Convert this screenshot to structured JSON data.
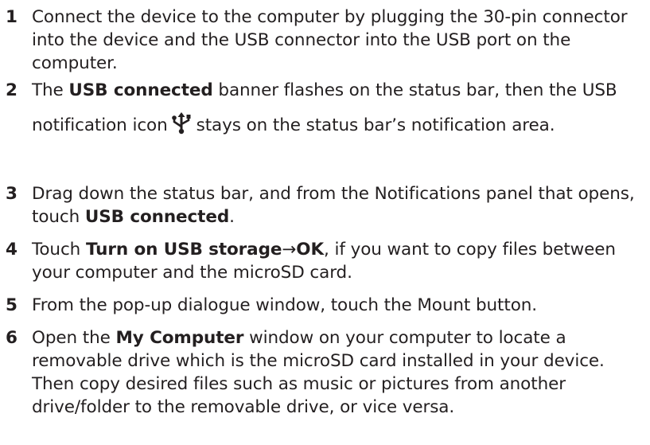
{
  "steps": [
    {
      "number": "1",
      "text": "Connect the device to the computer by plugging the 30-pin connector into the device and the USB connector into the USB port on the computer."
    },
    {
      "number": "2",
      "pre": "The ",
      "bold": "USB connected",
      "mid": " banner flashes on the status bar, then the USB notification icon",
      "icon": "usb-icon",
      "post": "stays on the status bar’s notification area."
    },
    {
      "number": "3",
      "pre": "Drag down the status bar, and from the Notifications panel that opens, touch ",
      "bold": "USB connected",
      "post": "."
    },
    {
      "number": "4",
      "pre": "Touch ",
      "bold1": "Turn on USB storage",
      "arrow": "→",
      "bold2": "OK",
      "post": ", if you want to copy files between your computer and the microSD card."
    },
    {
      "number": "5",
      "text": "From the pop-up dialogue window, touch the Mount button."
    },
    {
      "number": "6",
      "pre": "Open the ",
      "bold": "My Computer",
      "post": " window on your computer to locate a removable drive which is the microSD card installed in your device. Then copy desired files such as music or pictures from another drive/folder to the removable drive, or vice versa."
    }
  ]
}
